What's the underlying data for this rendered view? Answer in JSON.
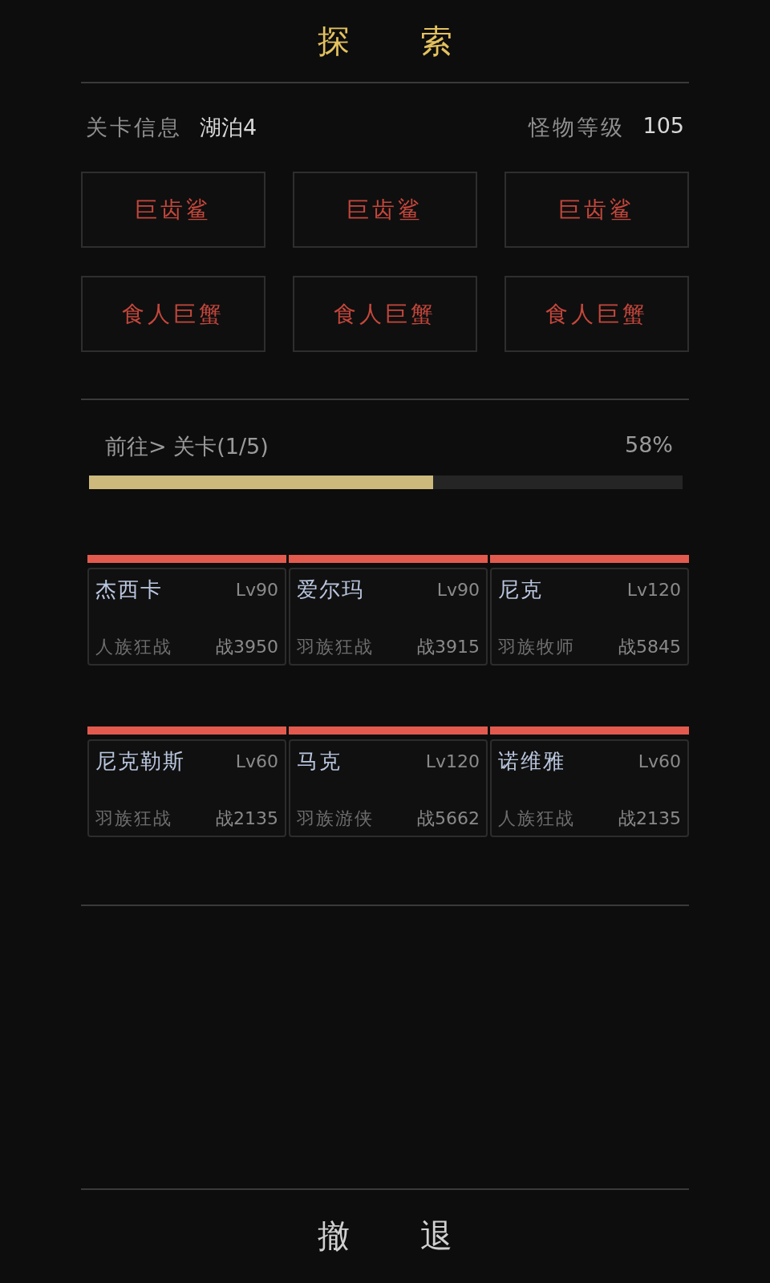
{
  "header": {
    "title": "探索"
  },
  "stage_info": {
    "label": "关卡信息",
    "value": "湖泊4",
    "monster_level_label": "怪物等级",
    "monster_level": "105"
  },
  "monsters": [
    {
      "name": "巨齿鲨"
    },
    {
      "name": "巨齿鲨"
    },
    {
      "name": "巨齿鲨"
    },
    {
      "name": "食人巨蟹"
    },
    {
      "name": "食人巨蟹"
    },
    {
      "name": "食人巨蟹"
    }
  ],
  "progress": {
    "label": "前往> 关卡(1/5)",
    "percent": "58%",
    "level": 0.58
  },
  "heroes": [
    {
      "name": "杰西卡",
      "lv": "Lv90",
      "class": "人族狂战",
      "power": "战3950",
      "level": 1
    },
    {
      "name": "爱尔玛",
      "lv": "Lv90",
      "class": "羽族狂战",
      "power": "战3915",
      "level": 1
    },
    {
      "name": "尼克",
      "lv": "Lv120",
      "class": "羽族牧师",
      "power": "战5845",
      "level": 1
    },
    {
      "name": "尼克勒斯",
      "lv": "Lv60",
      "class": "羽族狂战",
      "power": "战2135",
      "level": 1
    },
    {
      "name": "马克",
      "lv": "Lv120",
      "class": "羽族游侠",
      "power": "战5662",
      "level": 1
    },
    {
      "name": "诺维雅",
      "lv": "Lv60",
      "class": "人族狂战",
      "power": "战2135",
      "level": 1
    }
  ],
  "retreat_button": {
    "label": "撤退"
  }
}
